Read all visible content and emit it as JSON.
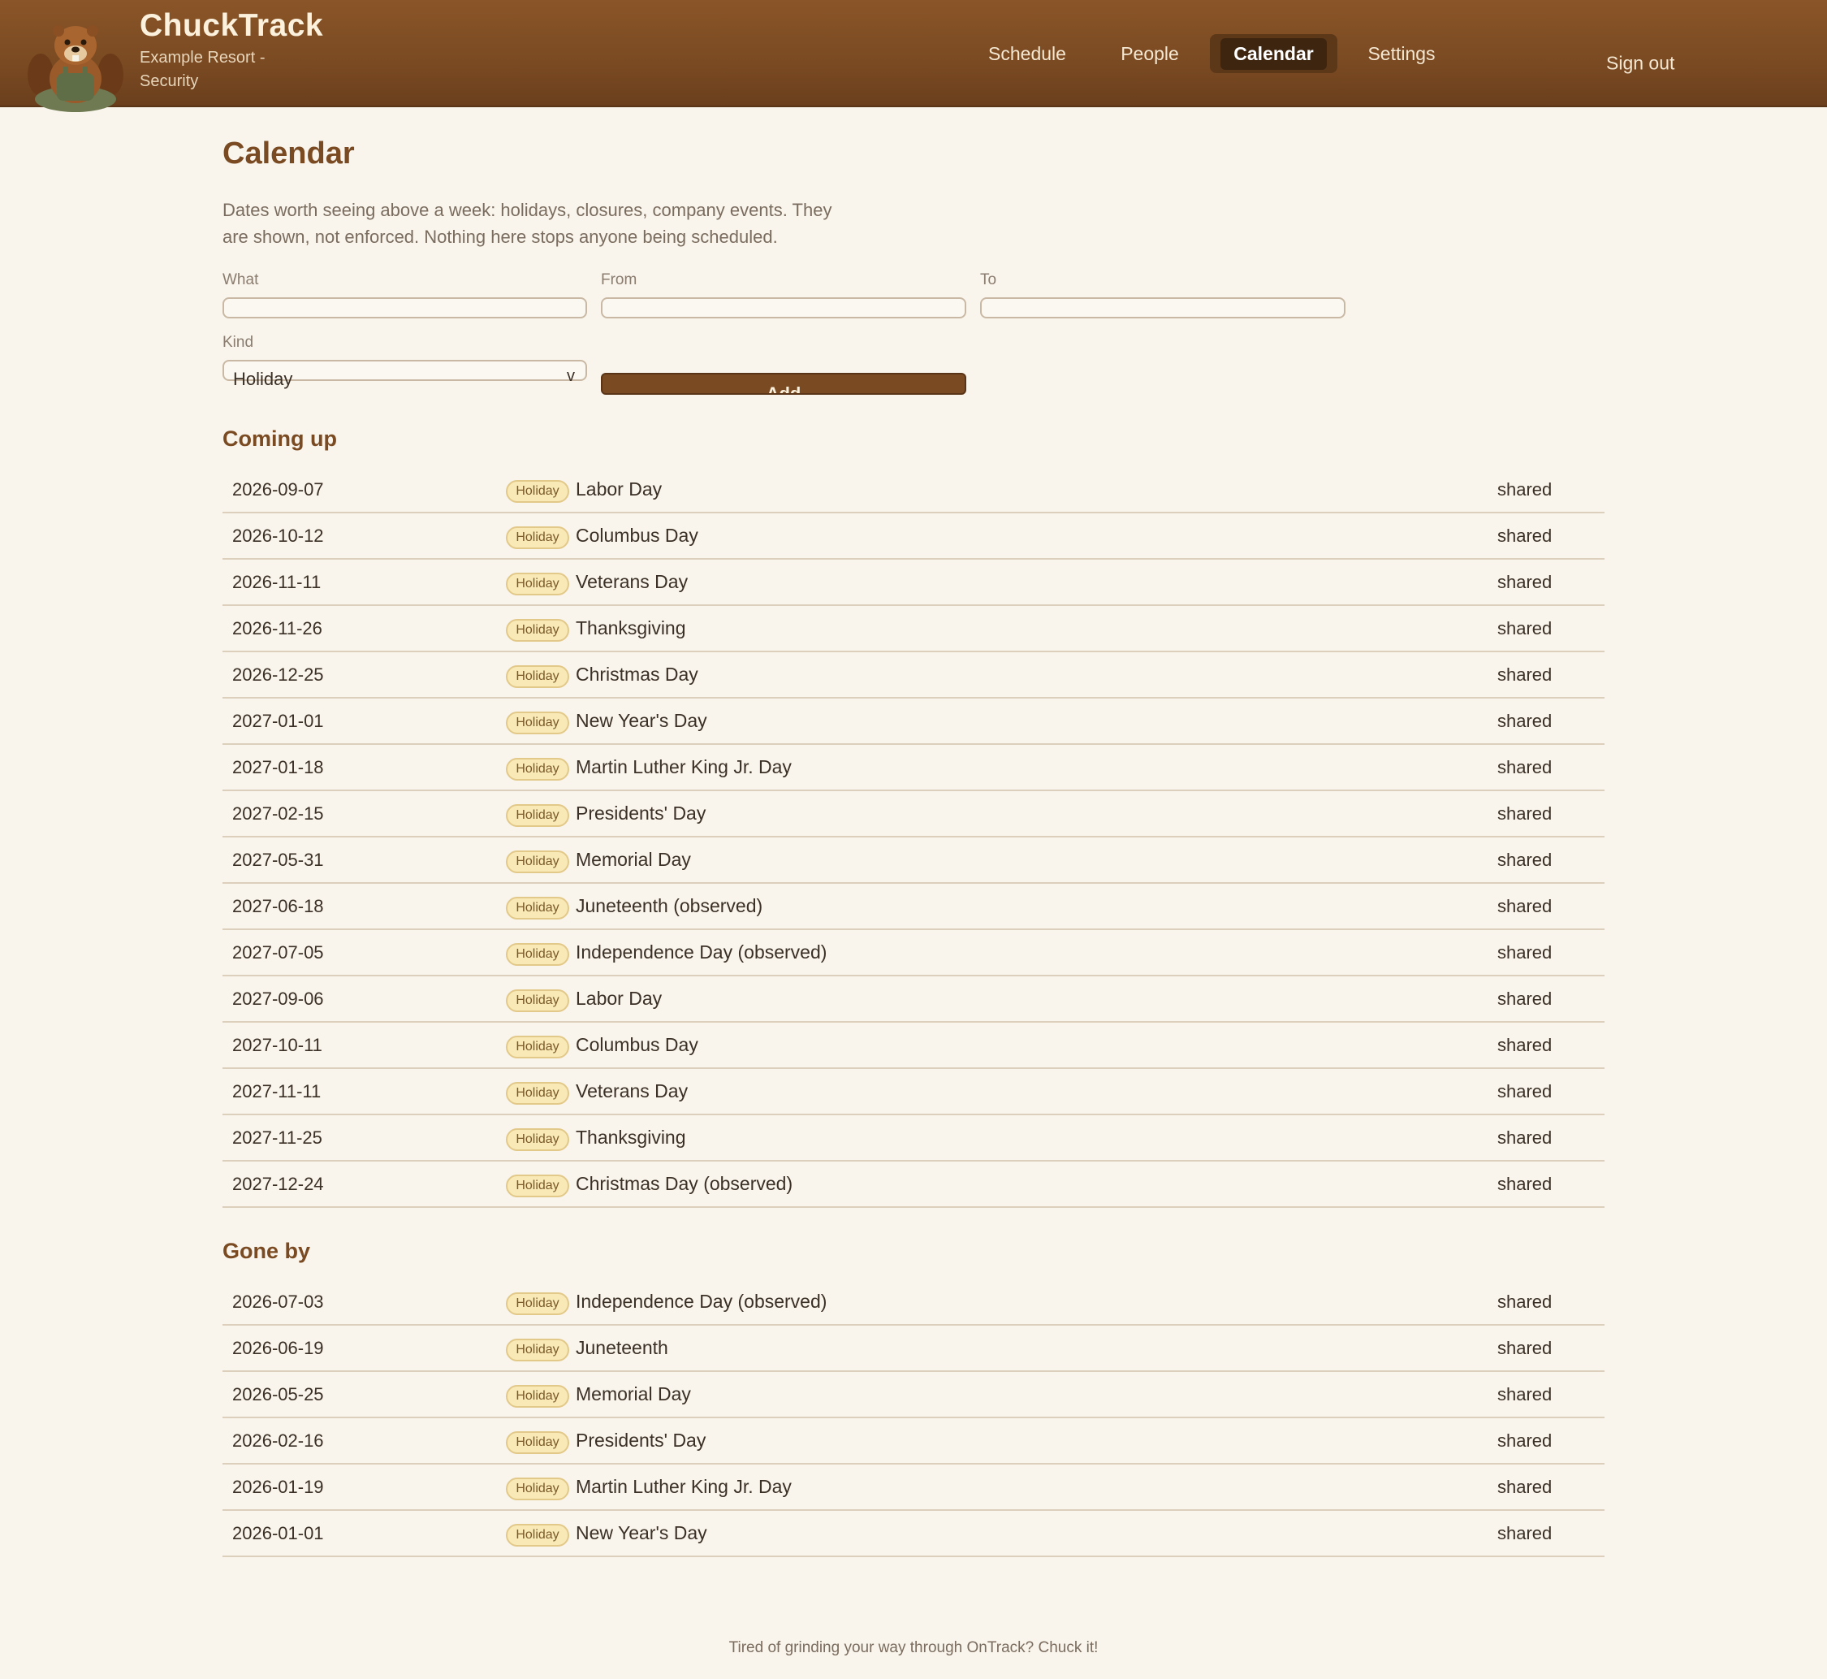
{
  "app": {
    "name": "ChuckTrack",
    "subtitle_line1": "Example Resort -",
    "subtitle_line2": "Security"
  },
  "nav": {
    "items": [
      {
        "label": "Schedule"
      },
      {
        "label": "People"
      },
      {
        "label": "Calendar"
      },
      {
        "label": "Settings"
      }
    ],
    "active": "Calendar",
    "sign_out": "Sign out"
  },
  "page": {
    "title": "Calendar",
    "intro_line1": "Dates worth seeing above a week: holidays, closures, company events. They",
    "intro_line2": "are shown, not enforced. Nothing here stops anyone being scheduled."
  },
  "form": {
    "what_label": "What",
    "what_value": "",
    "from_label": "From",
    "from_value": "",
    "to_label": "To",
    "to_value": "",
    "kind_label": "Kind",
    "kind_value": "Holiday",
    "kind_arrow": "v",
    "add_label": "Add"
  },
  "coming_up": {
    "heading": "Coming up",
    "rows": [
      {
        "date": "2026-09-07",
        "kind": "Holiday",
        "name": "Labor Day",
        "scope": "shared"
      },
      {
        "date": "2026-10-12",
        "kind": "Holiday",
        "name": "Columbus Day",
        "scope": "shared"
      },
      {
        "date": "2026-11-11",
        "kind": "Holiday",
        "name": "Veterans Day",
        "scope": "shared"
      },
      {
        "date": "2026-11-26",
        "kind": "Holiday",
        "name": "Thanksgiving",
        "scope": "shared"
      },
      {
        "date": "2026-12-25",
        "kind": "Holiday",
        "name": "Christmas Day",
        "scope": "shared"
      },
      {
        "date": "2027-01-01",
        "kind": "Holiday",
        "name": "New Year's Day",
        "scope": "shared"
      },
      {
        "date": "2027-01-18",
        "kind": "Holiday",
        "name": "Martin Luther King Jr. Day",
        "scope": "shared"
      },
      {
        "date": "2027-02-15",
        "kind": "Holiday",
        "name": "Presidents' Day",
        "scope": "shared"
      },
      {
        "date": "2027-05-31",
        "kind": "Holiday",
        "name": "Memorial Day",
        "scope": "shared"
      },
      {
        "date": "2027-06-18",
        "kind": "Holiday",
        "name": "Juneteenth (observed)",
        "scope": "shared"
      },
      {
        "date": "2027-07-05",
        "kind": "Holiday",
        "name": "Independence Day (observed)",
        "scope": "shared"
      },
      {
        "date": "2027-09-06",
        "kind": "Holiday",
        "name": "Labor Day",
        "scope": "shared"
      },
      {
        "date": "2027-10-11",
        "kind": "Holiday",
        "name": "Columbus Day",
        "scope": "shared"
      },
      {
        "date": "2027-11-11",
        "kind": "Holiday",
        "name": "Veterans Day",
        "scope": "shared"
      },
      {
        "date": "2027-11-25",
        "kind": "Holiday",
        "name": "Thanksgiving",
        "scope": "shared"
      },
      {
        "date": "2027-12-24",
        "kind": "Holiday",
        "name": "Christmas Day (observed)",
        "scope": "shared"
      }
    ]
  },
  "gone_by": {
    "heading": "Gone by",
    "rows": [
      {
        "date": "2026-07-03",
        "kind": "Holiday",
        "name": "Independence Day (observed)",
        "scope": "shared"
      },
      {
        "date": "2026-06-19",
        "kind": "Holiday",
        "name": "Juneteenth",
        "scope": "shared"
      },
      {
        "date": "2026-05-25",
        "kind": "Holiday",
        "name": "Memorial Day",
        "scope": "shared"
      },
      {
        "date": "2026-02-16",
        "kind": "Holiday",
        "name": "Presidents' Day",
        "scope": "shared"
      },
      {
        "date": "2026-01-19",
        "kind": "Holiday",
        "name": "Martin Luther King Jr. Day",
        "scope": "shared"
      },
      {
        "date": "2026-01-01",
        "kind": "Holiday",
        "name": "New Year's Day",
        "scope": "shared"
      }
    ]
  },
  "footer": {
    "text": "Tired of grinding your way through OnTrack? Chuck it!"
  },
  "colors": {
    "header_brown": "#7a4a22",
    "accent_brown": "#7a4a22",
    "page_background": "#f9f5ec",
    "badge_fill": "#f8e9b6",
    "badge_border": "#e2c98a"
  },
  "icons": {
    "logo": "beaver-mascot-icon",
    "select_arrow": "chevron-down-icon"
  }
}
